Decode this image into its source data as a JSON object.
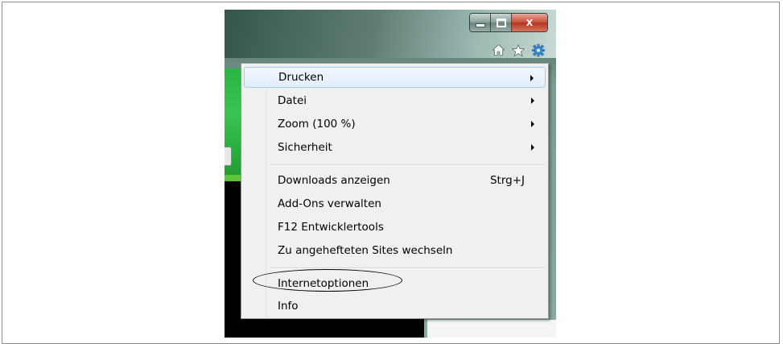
{
  "window": {
    "controls": {
      "minimize_icon": "minimize-icon",
      "maximize_icon": "maximize-icon",
      "close_icon": "close-icon",
      "close_glyph": "X"
    },
    "toolbar_icons": [
      "home-icon",
      "star-icon",
      "gear-icon"
    ]
  },
  "menu": {
    "groups": [
      {
        "items": [
          {
            "label": "Drucken",
            "submenu": true,
            "highlighted": true
          },
          {
            "label": "Datei",
            "submenu": true
          },
          {
            "label": "Zoom (100 %)",
            "submenu": true
          },
          {
            "label": "Sicherheit",
            "submenu": true
          }
        ]
      },
      {
        "items": [
          {
            "label": "Downloads anzeigen",
            "shortcut": "Strg+J"
          },
          {
            "label": "Add-Ons verwalten"
          },
          {
            "label": "F12 Entwicklertools"
          },
          {
            "label": "Zu angehefteten Sites wechseln"
          }
        ]
      },
      {
        "items": [
          {
            "label": "Internetoptionen",
            "circled": true
          },
          {
            "label": "Info"
          }
        ]
      }
    ]
  },
  "colors": {
    "hover_border": "#a9c8ee",
    "gear_icon": "#3d8fd6",
    "close_button": "#c9503b",
    "page_green": "#2ab545"
  }
}
